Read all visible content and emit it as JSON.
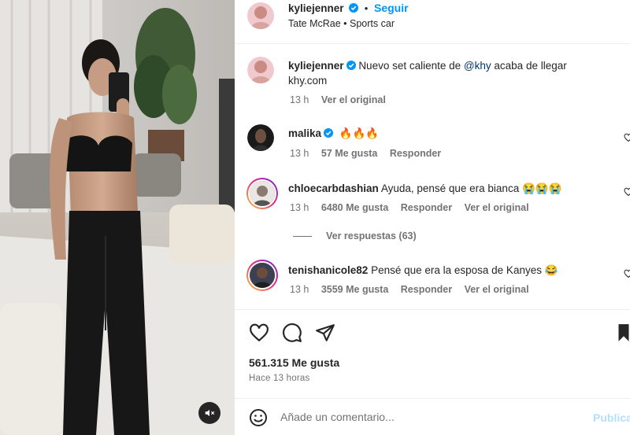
{
  "header": {
    "username": "kyliejenner",
    "follow_label": "Seguir",
    "audio": "Tate McRae • Sports car"
  },
  "caption": {
    "username": "kyliejenner",
    "text_before": "Nuevo set caliente de",
    "mention": "@khy",
    "text_after": "acaba de llegar",
    "line2": "khy.com",
    "time": "13 h",
    "translate": "Ver el original"
  },
  "comments": [
    {
      "username": "malika",
      "verified": true,
      "text": "🔥🔥🔥",
      "time": "13 h",
      "likes": "57 Me gusta",
      "reply": "Responder",
      "translate": ""
    },
    {
      "username": "chloecarbdashian",
      "verified": false,
      "text": "Ayuda, pensé que era bianca 😭😭😭",
      "time": "13 h",
      "likes": "6480 Me gusta",
      "reply": "Responder",
      "translate": "Ver el original"
    },
    {
      "username": "tenishanicole82",
      "verified": false,
      "text": "Pensé que era la esposa de Kanyes 😂",
      "time": "13 h",
      "likes": "3559 Me gusta",
      "reply": "Responder",
      "translate": "Ver el original"
    }
  ],
  "replies_label": "Ver respuestas (63)",
  "post": {
    "likes": "561.315 Me gusta",
    "time": "Hace 13 horas"
  },
  "comment_box": {
    "placeholder": "Añade un comentario...",
    "post_label": "Publicar"
  },
  "icons": {
    "verified": "verified-badge-icon",
    "like": "heart-icon",
    "comment": "comment-bubble-icon",
    "share": "paper-plane-icon",
    "save": "bookmark-icon",
    "emoji": "smiley-icon",
    "mute": "speaker-muted-icon"
  },
  "colors": {
    "accent": "#0095f6",
    "verified": "#0095f6",
    "muted_text": "#737373",
    "post_disabled": "#b2dffc"
  }
}
